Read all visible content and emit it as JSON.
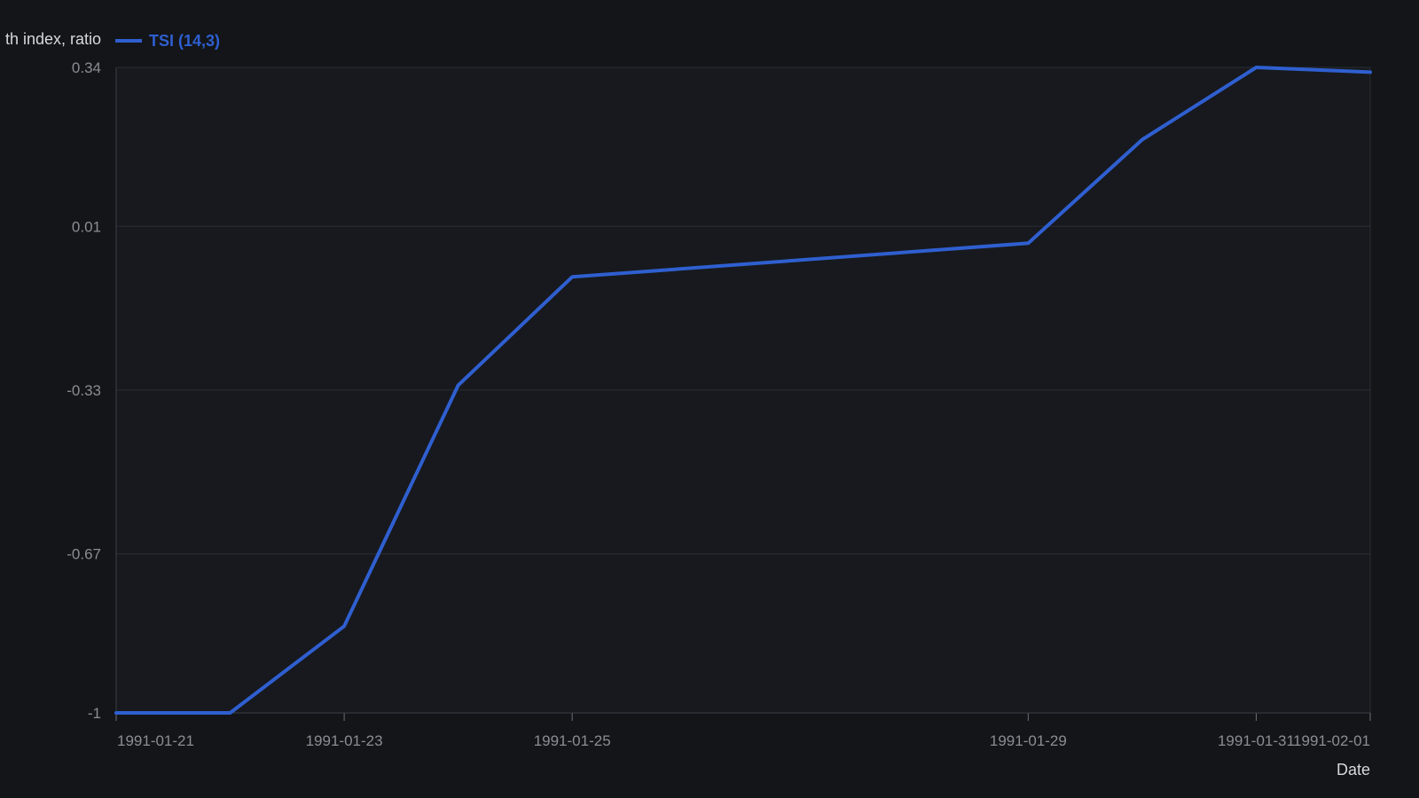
{
  "chart_data": {
    "type": "line",
    "ylabel": "th index, ratio",
    "xlabel": "Date",
    "legend": {
      "position": "top-left",
      "entries": [
        {
          "name": "TSI (14,3)",
          "color": "#2f5fd0"
        }
      ]
    },
    "x_ticks": [
      "1991-01-21",
      "1991-01-23",
      "1991-01-25",
      "1991-01-29",
      "1991-01-31",
      "1991-02-01"
    ],
    "y_ticks": [
      "0.34",
      "0.01",
      "-0.33",
      "-0.67",
      "-1"
    ],
    "y_tick_values": [
      0.34,
      0.01,
      -0.33,
      -0.67,
      -1
    ],
    "ylim": [
      -1,
      0.34
    ],
    "xlim": [
      "1991-01-21",
      "1991-02-01"
    ],
    "grid": true,
    "series": [
      {
        "name": "TSI (14,3)",
        "color": "#2f5fd0",
        "x": [
          "1991-01-21",
          "1991-01-22",
          "1991-01-23",
          "1991-01-24",
          "1991-01-25",
          "1991-01-29",
          "1991-01-30",
          "1991-01-31",
          "1991-02-01"
        ],
        "y": [
          -1.0,
          -1.0,
          -0.82,
          -0.32,
          -0.095,
          -0.025,
          0.19,
          0.34,
          0.33
        ]
      }
    ]
  },
  "colors": {
    "background": "#131519",
    "plot_background": "#17191e",
    "grid": "#2a2d33",
    "axis": "#3a3d44",
    "series": "#2f5fd0"
  }
}
